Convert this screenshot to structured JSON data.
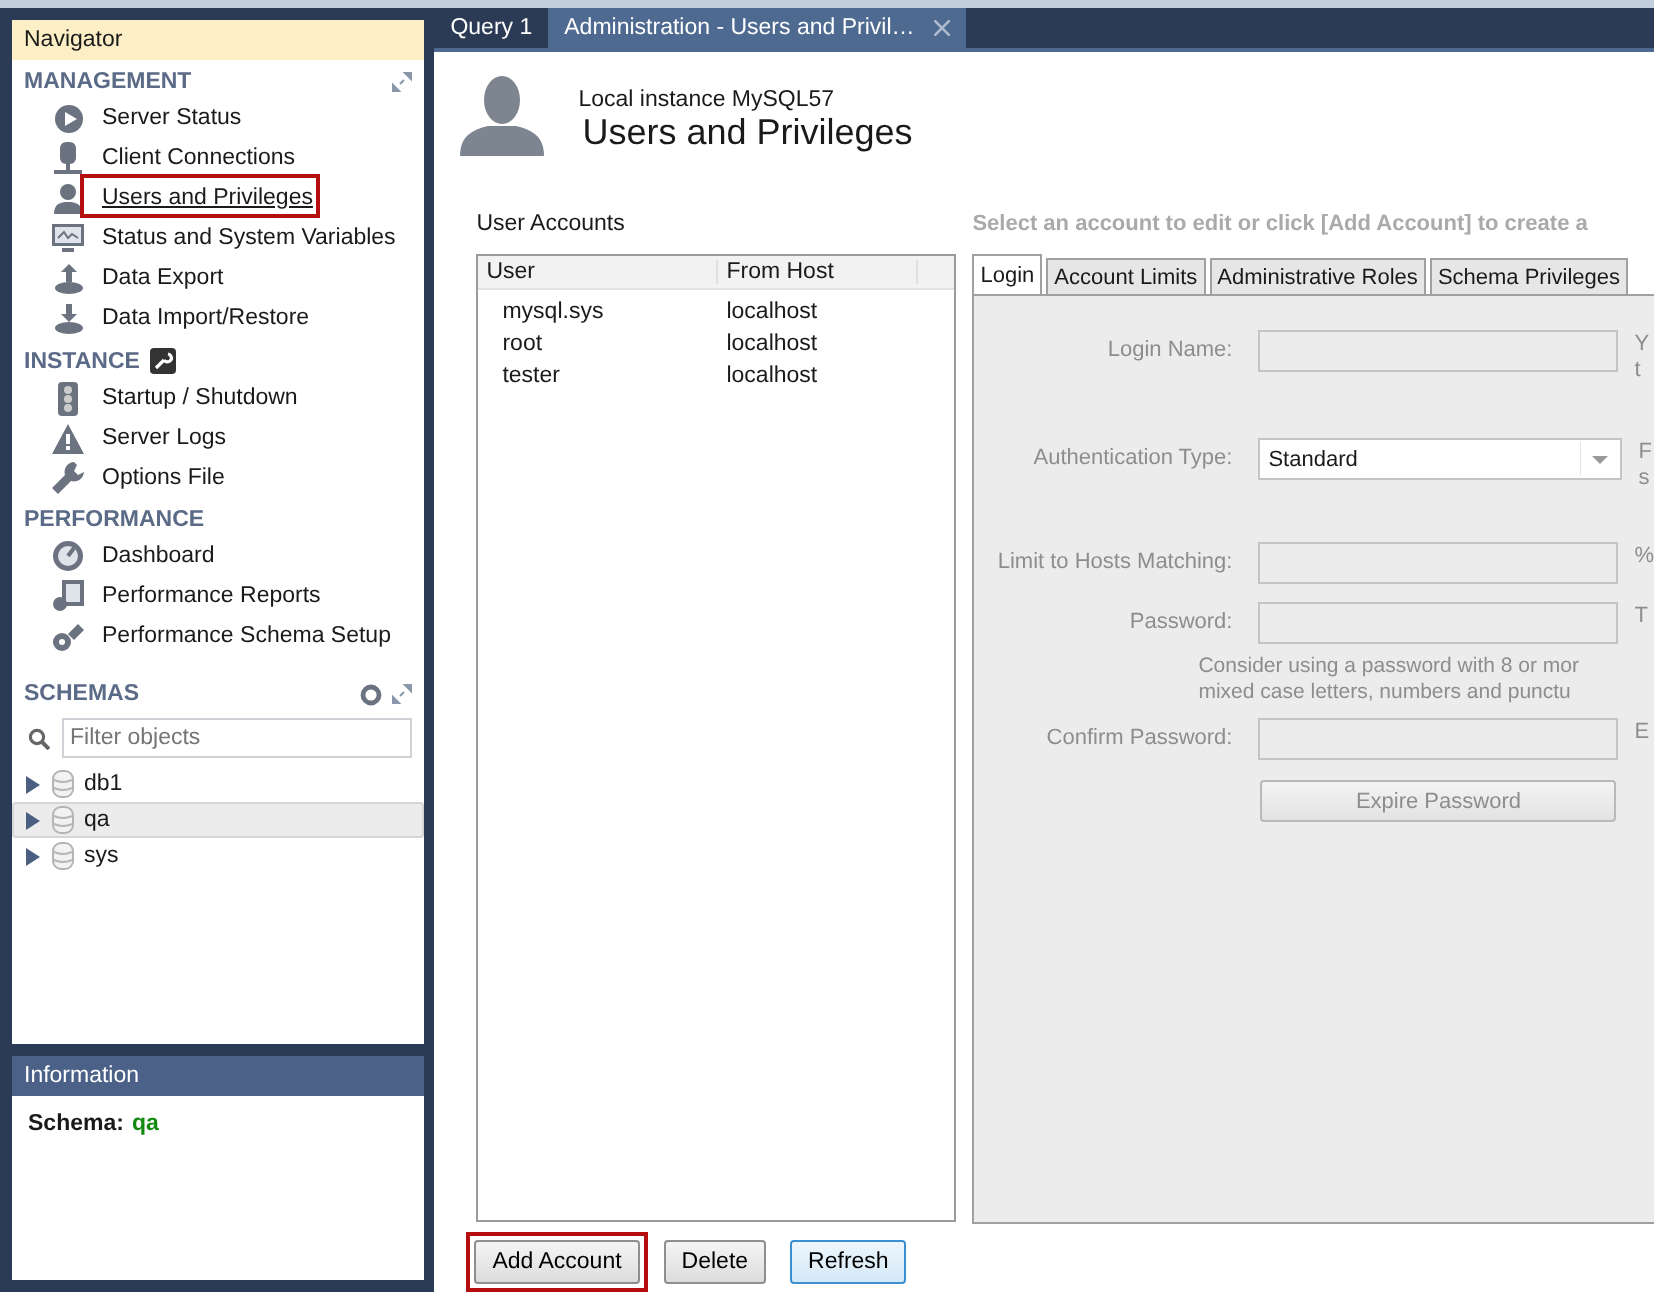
{
  "tabs": [
    {
      "label": "Query 1",
      "selected": false,
      "closable": false
    },
    {
      "label": "Administration - Users and Privil…",
      "selected": true,
      "closable": true
    }
  ],
  "navigator": {
    "title": "Navigator",
    "sections": [
      {
        "title": "MANAGEMENT",
        "items": [
          {
            "label": "Server Status",
            "selected": false,
            "annotated": false
          },
          {
            "label": "Client Connections",
            "selected": false,
            "annotated": false
          },
          {
            "label": "Users and Privileges",
            "selected": true,
            "annotated": true
          },
          {
            "label": "Status and System Variables",
            "selected": false,
            "annotated": false
          },
          {
            "label": "Data Export",
            "selected": false,
            "annotated": false
          },
          {
            "label": "Data Import/Restore",
            "selected": false,
            "annotated": false
          }
        ]
      },
      {
        "title": "INSTANCE",
        "items": [
          {
            "label": "Startup / Shutdown",
            "selected": false,
            "annotated": false
          },
          {
            "label": "Server Logs",
            "selected": false,
            "annotated": false
          },
          {
            "label": "Options File",
            "selected": false,
            "annotated": false
          }
        ]
      },
      {
        "title": "PERFORMANCE",
        "items": [
          {
            "label": "Dashboard",
            "selected": false,
            "annotated": false
          },
          {
            "label": "Performance Reports",
            "selected": false,
            "annotated": false
          },
          {
            "label": "Performance Schema Setup",
            "selected": false,
            "annotated": false
          }
        ]
      }
    ]
  },
  "schemas": {
    "title": "SCHEMAS",
    "filter": {
      "placeholder": "Filter objects"
    },
    "items": [
      {
        "label": "db1",
        "selected": false,
        "expanded": false
      },
      {
        "label": "qa",
        "selected": true,
        "expanded": false
      },
      {
        "label": "sys",
        "selected": false,
        "expanded": false
      }
    ]
  },
  "information": {
    "title": "Information",
    "schema_label": "Schema:",
    "schema_value": "qa"
  },
  "header": {
    "subtitle": "Local instance MySQL57",
    "title": "Users and Privileges"
  },
  "accounts": {
    "label": "User Accounts",
    "columns": [
      "User",
      "From Host"
    ],
    "rows": [
      [
        "mysql.sys",
        "localhost"
      ],
      [
        "root",
        "localhost"
      ],
      [
        "tester",
        "localhost"
      ]
    ]
  },
  "detail": {
    "instruction": "Select an account to edit or click [Add Account] to create a",
    "tabs": [
      {
        "label": "Login",
        "selected": true
      },
      {
        "label": "Account Limits",
        "selected": false
      },
      {
        "label": "Administrative Roles",
        "selected": false
      },
      {
        "label": "Schema Privileges",
        "selected": false
      }
    ],
    "disabled": true,
    "form": [
      {
        "kind": "text",
        "label": "Login Name:",
        "hint": [
          "Y",
          "t"
        ]
      },
      {
        "kind": "select",
        "label": "Authentication Type:",
        "value": "Standard",
        "hint": [
          "F",
          "s"
        ]
      },
      {
        "kind": "text",
        "label": "Limit to Hosts Matching:",
        "hint": [
          "%"
        ]
      },
      {
        "kind": "text",
        "label": "Password:",
        "hint": [
          "T"
        ]
      },
      {
        "kind": "note",
        "lines": [
          "Consider using a password with 8 or mor",
          "mixed case letters, numbers and punctu"
        ]
      },
      {
        "kind": "text",
        "label": "Confirm Password:",
        "hint": [
          "E"
        ]
      },
      {
        "kind": "button",
        "label": "Expire Password"
      }
    ]
  },
  "buttons": [
    {
      "label": "Add Account",
      "focused": false,
      "annotated": true
    },
    {
      "label": "Delete",
      "focused": false,
      "annotated": false
    },
    {
      "label": "Refresh",
      "focused": true,
      "annotated": false
    }
  ]
}
